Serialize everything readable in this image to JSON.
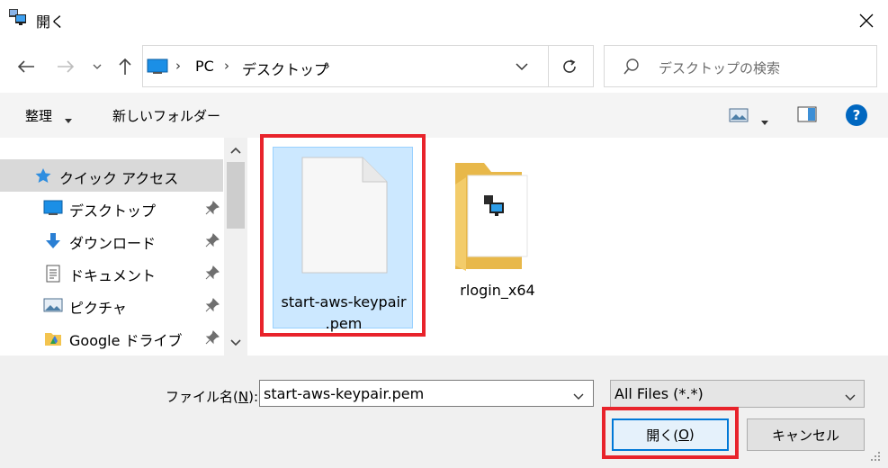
{
  "window": {
    "title": "開く"
  },
  "address": {
    "crumbs": [
      "PC",
      "デスクトップ"
    ]
  },
  "search": {
    "placeholder": "デスクトップの検索"
  },
  "toolbar": {
    "organize": "整理",
    "new_folder": "新しいフォルダー",
    "help": "?"
  },
  "nav": {
    "items": [
      {
        "label": "クイック アクセス",
        "icon": "star-icon"
      },
      {
        "label": "デスクトップ",
        "icon": "desktop-icon",
        "pinned": true
      },
      {
        "label": "ダウンロード",
        "icon": "download-arrow-icon",
        "pinned": true
      },
      {
        "label": "ドキュメント",
        "icon": "document-icon",
        "pinned": true
      },
      {
        "label": "ピクチャ",
        "icon": "pictures-icon",
        "pinned": true
      },
      {
        "label": "Google ドライブ",
        "icon": "google-drive-icon",
        "pinned": true
      }
    ]
  },
  "files": [
    {
      "line1": "start-aws-keypair",
      "line2": ".pem",
      "icon": "blank-file-icon",
      "selected": true
    },
    {
      "name": "rlogin_x64",
      "icon": "folder-icon"
    }
  ],
  "bottom": {
    "filename_label": "ファイル名(",
    "filename_key": "N",
    "filename_label_end": "):",
    "filename_value": "start-aws-keypair.pem",
    "filter_value": "All Files (*.*)",
    "open_label": "開く(",
    "open_key": "O",
    "open_label_end": ")",
    "cancel_label": "キャンセル"
  },
  "colors": {
    "accent": "#0078d7",
    "selection": "#cce8ff",
    "highlight": "#e8232b"
  }
}
